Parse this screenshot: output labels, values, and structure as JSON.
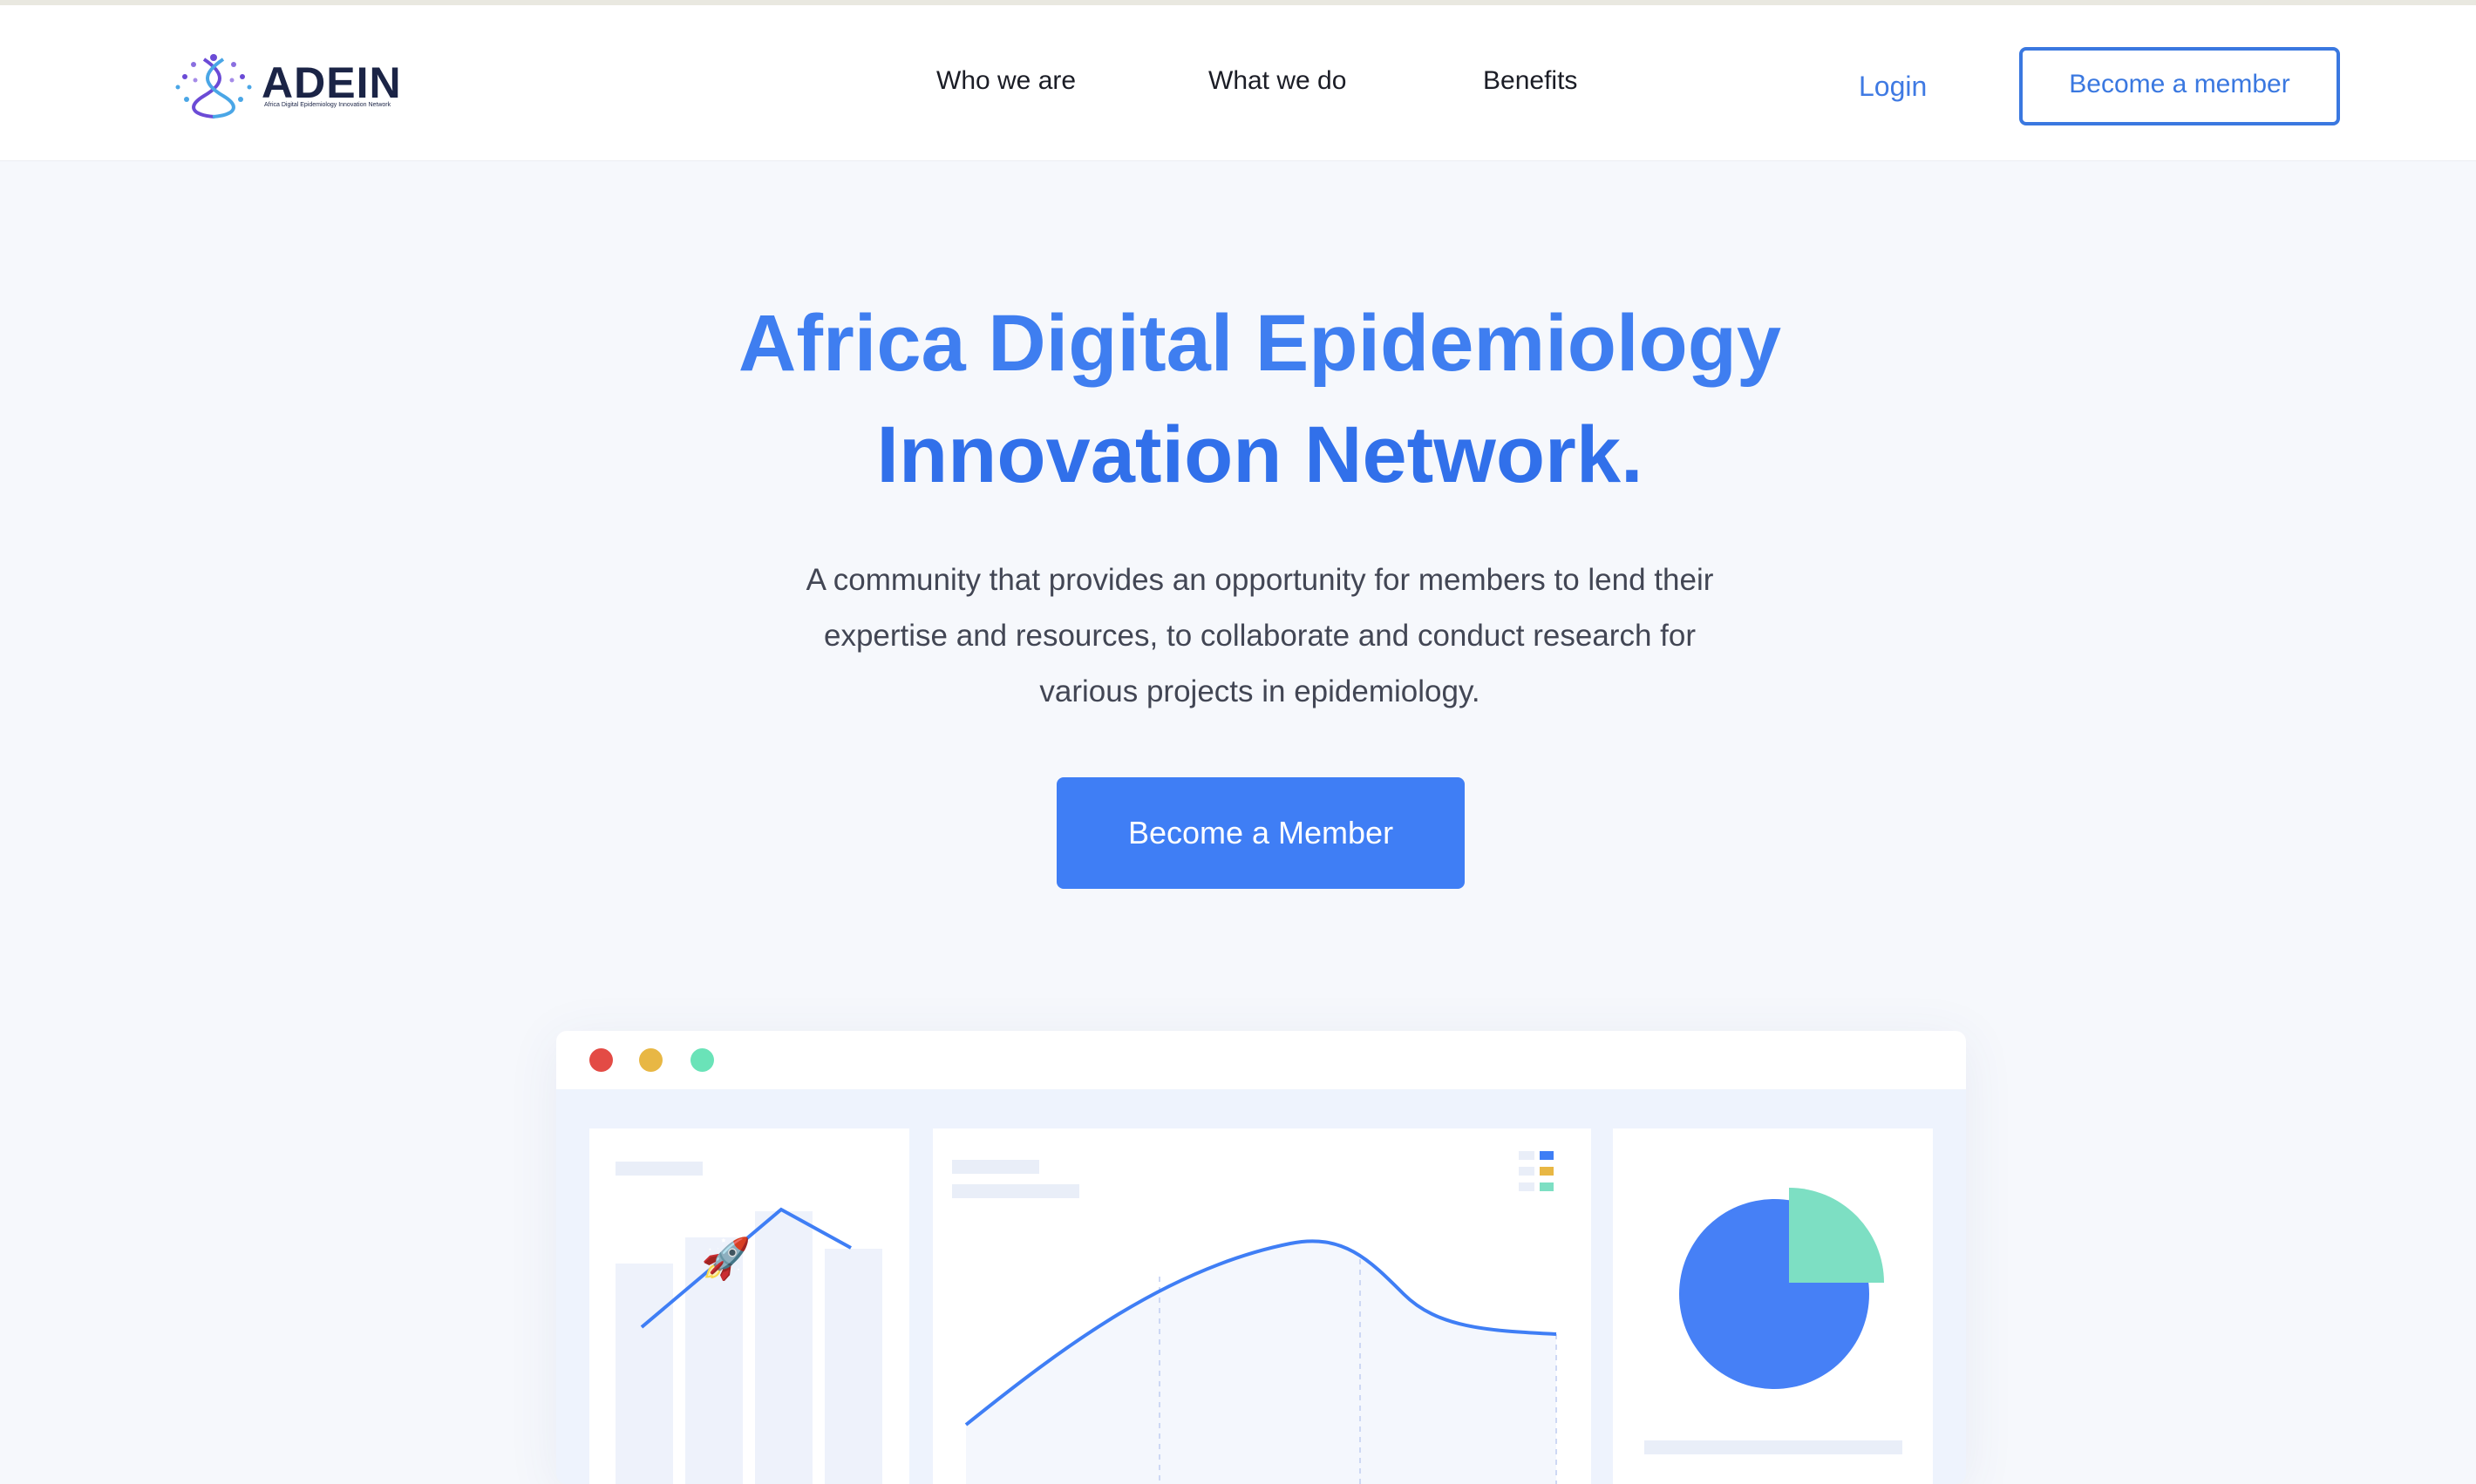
{
  "header": {
    "logo": {
      "name": "ADEIN",
      "tagline": "Africa Digital Epidemiology Innovation Network"
    },
    "nav": [
      {
        "label": "Who we are"
      },
      {
        "label": "What we do"
      },
      {
        "label": "Benefits"
      }
    ],
    "login_label": "Login",
    "member_button_label": "Become a member"
  },
  "hero": {
    "title_line1": "Africa Digital Epidemiology",
    "title_line2": "Innovation Network.",
    "subtitle_lines": [
      "A community that provides an opportunity for members to lend their",
      "expertise and resources, to collaborate and conduct research for",
      "various projects in epidemiology."
    ],
    "cta_label": "Become a Member"
  },
  "illustration": {
    "window_dots": [
      "red",
      "yellow",
      "green"
    ],
    "rocket_emoji": "🚀",
    "colors": {
      "accent_blue": "#3f7ef5",
      "teal": "#7ddfc3",
      "amber": "#e8b744",
      "red": "#e34b45",
      "placeholder": "#e9eef8"
    }
  },
  "colors": {
    "title_blue": "#3f7ef0",
    "link_blue": "#3f7ae3",
    "dark_text": "#1b2446",
    "background": "#f6f8fc"
  }
}
